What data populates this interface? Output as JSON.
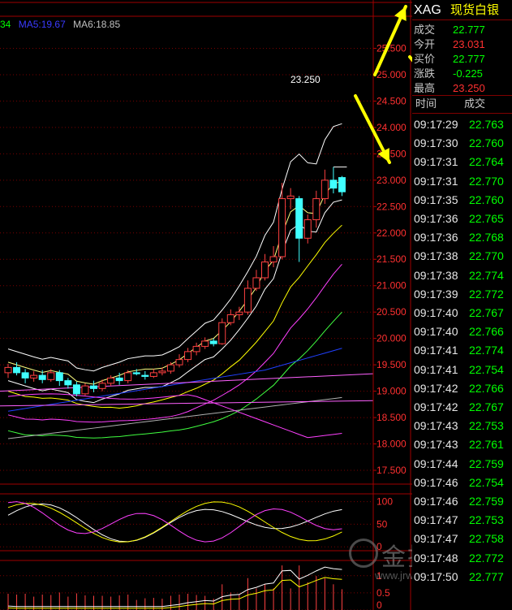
{
  "instrument": {
    "code": "XAG",
    "name": "现货白银"
  },
  "ma_legend": [
    {
      "label": "34",
      "color": "#00ff00"
    },
    {
      "label": "MA5:19.67",
      "color": "#0000ff"
    },
    {
      "label": "MA6:18.85",
      "color": "#c0c0c0"
    }
  ],
  "quote": [
    {
      "label": "成交",
      "value": "22.777",
      "color": "#00ff00"
    },
    {
      "label": "今开",
      "value": "23.031",
      "color": "#ff3030"
    },
    {
      "label": "买价",
      "value": "22.777",
      "color": "#00ff00"
    },
    {
      "label": "涨跌",
      "value": "-0.225",
      "color": "#00ff00"
    },
    {
      "label": "最高",
      "value": "23.250",
      "color": "#ff3030"
    }
  ],
  "ticks_header": {
    "time": "时间",
    "price": "成交"
  },
  "ticks": [
    {
      "time": "09:17:29",
      "price": "22.763"
    },
    {
      "time": "09:17:30",
      "price": "22.760"
    },
    {
      "time": "09:17:31",
      "price": "22.764"
    },
    {
      "time": "09:17:31",
      "price": "22.770"
    },
    {
      "time": "09:17:35",
      "price": "22.760"
    },
    {
      "time": "09:17:36",
      "price": "22.765"
    },
    {
      "time": "09:17:36",
      "price": "22.768"
    },
    {
      "time": "09:17:38",
      "price": "22.770"
    },
    {
      "time": "09:17:38",
      "price": "22.774"
    },
    {
      "time": "09:17:39",
      "price": "22.772"
    },
    {
      "time": "09:17:40",
      "price": "22.767"
    },
    {
      "time": "09:17:40",
      "price": "22.766"
    },
    {
      "time": "09:17:41",
      "price": "22.774"
    },
    {
      "time": "09:17:41",
      "price": "22.754"
    },
    {
      "time": "09:17:42",
      "price": "22.766"
    },
    {
      "time": "09:17:42",
      "price": "22.767"
    },
    {
      "time": "09:17:43",
      "price": "22.753"
    },
    {
      "time": "09:17:43",
      "price": "22.761"
    },
    {
      "time": "09:17:44",
      "price": "22.759"
    },
    {
      "time": "09:17:46",
      "price": "22.754"
    },
    {
      "time": "09:17:46",
      "price": "22.759"
    },
    {
      "time": "09:17:47",
      "price": "22.753"
    },
    {
      "time": "09:17:47",
      "price": "22.758"
    },
    {
      "time": "09:17:48",
      "price": "22.772"
    },
    {
      "time": "09:17:50",
      "price": "22.777"
    }
  ],
  "tick_colors": {
    "up": "#00ff00"
  },
  "watermark": {
    "text": "金投网",
    "url": "www.jrwei.com"
  },
  "chart_data": [
    {
      "type": "candlestick",
      "title": "",
      "ylim": [
        17.3,
        25.8
      ],
      "y_ticks": [
        "25.500",
        "25.000",
        "24.500",
        "24.000",
        "23.500",
        "23.000",
        "22.500",
        "22.000",
        "21.500",
        "21.000",
        "20.500",
        "20.000",
        "19.500",
        "19.000",
        "18.500",
        "18.000",
        "17.500"
      ],
      "annotation": {
        "label": "23.250",
        "value": 23.25
      },
      "candles": [
        {
          "o": 19.35,
          "c": 19.45,
          "h": 19.52,
          "l": 19.25
        },
        {
          "o": 19.45,
          "c": 19.35,
          "h": 19.55,
          "l": 19.3
        },
        {
          "o": 19.35,
          "c": 19.25,
          "h": 19.42,
          "l": 19.15
        },
        {
          "o": 19.25,
          "c": 19.3,
          "h": 19.38,
          "l": 19.18
        },
        {
          "o": 19.3,
          "c": 19.22,
          "h": 19.4,
          "l": 19.15
        },
        {
          "o": 19.22,
          "c": 19.35,
          "h": 19.42,
          "l": 19.18
        },
        {
          "o": 19.35,
          "c": 19.2,
          "h": 19.4,
          "l": 19.1
        },
        {
          "o": 19.2,
          "c": 19.12,
          "h": 19.25,
          "l": 19.05
        },
        {
          "o": 19.12,
          "c": 18.95,
          "h": 19.18,
          "l": 18.9
        },
        {
          "o": 18.95,
          "c": 19.1,
          "h": 19.15,
          "l": 18.92
        },
        {
          "o": 19.1,
          "c": 19.05,
          "h": 19.2,
          "l": 18.98
        },
        {
          "o": 19.05,
          "c": 19.15,
          "h": 19.22,
          "l": 19.0
        },
        {
          "o": 19.15,
          "c": 19.25,
          "h": 19.3,
          "l": 19.1
        },
        {
          "o": 19.25,
          "c": 19.2,
          "h": 19.35,
          "l": 19.12
        },
        {
          "o": 19.2,
          "c": 19.35,
          "h": 19.4,
          "l": 19.15
        },
        {
          "o": 19.35,
          "c": 19.33,
          "h": 19.42,
          "l": 19.3
        },
        {
          "o": 19.3,
          "c": 19.28,
          "h": 19.38,
          "l": 19.22
        },
        {
          "o": 19.28,
          "c": 19.35,
          "h": 19.42,
          "l": 19.25
        },
        {
          "o": 19.35,
          "c": 19.38,
          "h": 19.45,
          "l": 19.3
        },
        {
          "o": 19.38,
          "c": 19.5,
          "h": 19.55,
          "l": 19.33
        },
        {
          "o": 19.5,
          "c": 19.6,
          "h": 19.7,
          "l": 19.45
        },
        {
          "o": 19.6,
          "c": 19.75,
          "h": 19.82,
          "l": 19.55
        },
        {
          "o": 19.75,
          "c": 19.85,
          "h": 19.92,
          "l": 19.68
        },
        {
          "o": 19.85,
          "c": 19.95,
          "h": 20.02,
          "l": 19.8
        },
        {
          "o": 19.95,
          "c": 19.9,
          "h": 20.0,
          "l": 19.85
        },
        {
          "o": 19.9,
          "c": 20.3,
          "h": 20.38,
          "l": 19.88
        },
        {
          "o": 20.3,
          "c": 20.45,
          "h": 20.55,
          "l": 20.25
        },
        {
          "o": 20.45,
          "c": 20.5,
          "h": 20.6,
          "l": 20.35
        },
        {
          "o": 20.5,
          "c": 20.95,
          "h": 21.1,
          "l": 20.45
        },
        {
          "o": 20.95,
          "c": 21.15,
          "h": 21.3,
          "l": 20.9
        },
        {
          "o": 21.15,
          "c": 21.45,
          "h": 21.6,
          "l": 21.1
        },
        {
          "o": 21.45,
          "c": 21.55,
          "h": 21.75,
          "l": 21.35
        },
        {
          "o": 21.55,
          "c": 22.65,
          "h": 22.95,
          "l": 21.5
        },
        {
          "o": 22.65,
          "c": 22.7,
          "h": 22.85,
          "l": 22.45
        },
        {
          "o": 22.65,
          "c": 21.9,
          "h": 22.7,
          "l": 21.45
        },
        {
          "o": 21.9,
          "c": 22.25,
          "h": 22.35,
          "l": 21.8
        },
        {
          "o": 22.25,
          "c": 22.65,
          "h": 22.8,
          "l": 22.1
        },
        {
          "o": 22.65,
          "c": 23.0,
          "h": 23.2,
          "l": 22.55
        },
        {
          "o": 23.0,
          "c": 22.85,
          "h": 23.25,
          "l": 22.75
        },
        {
          "o": 23.05,
          "c": 22.78,
          "h": 23.08,
          "l": 22.7
        }
      ]
    },
    {
      "type": "line",
      "title": "",
      "ylim": [
        -5,
        110
      ],
      "y_ticks": [
        "100",
        "50",
        "0"
      ]
    },
    {
      "type": "bar",
      "title": "",
      "ylim": [
        0,
        1.35
      ],
      "y_ticks": [
        "1",
        "0.5",
        "0"
      ]
    }
  ]
}
